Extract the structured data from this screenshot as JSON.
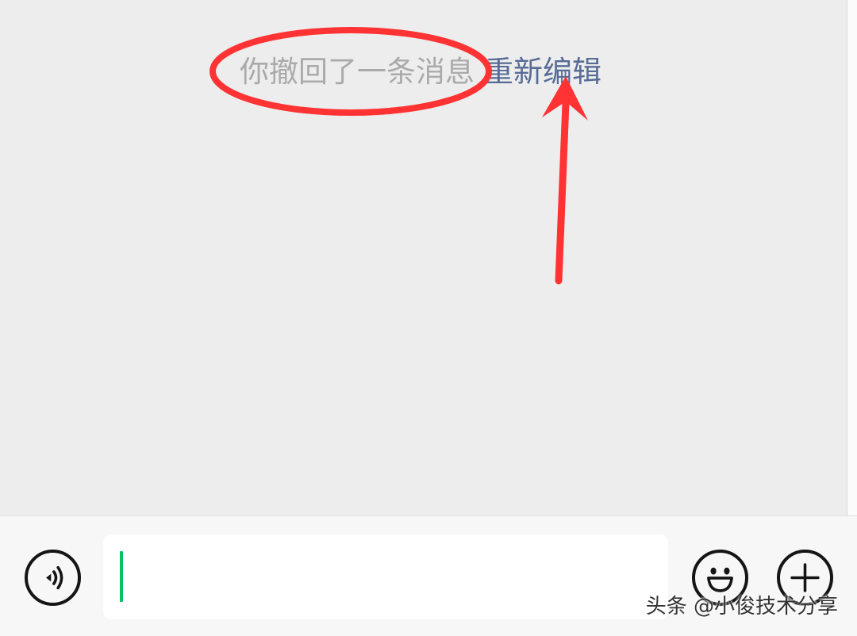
{
  "chat": {
    "system_message": {
      "recalled_text": "你撤回了一条消息",
      "reedit_label": "重新编辑"
    }
  },
  "input_bar": {
    "voice_icon": "voice-wave-icon",
    "emoji_icon": "smiley-face-icon",
    "more_icon": "plus-icon",
    "text_value": ""
  },
  "watermark": "头条 @小俊技术分享",
  "colors": {
    "background": "#ededed",
    "recalled_text": "#aaaaaa",
    "link": "#576b95",
    "caret": "#07c160",
    "annotation": "#ff3333"
  }
}
